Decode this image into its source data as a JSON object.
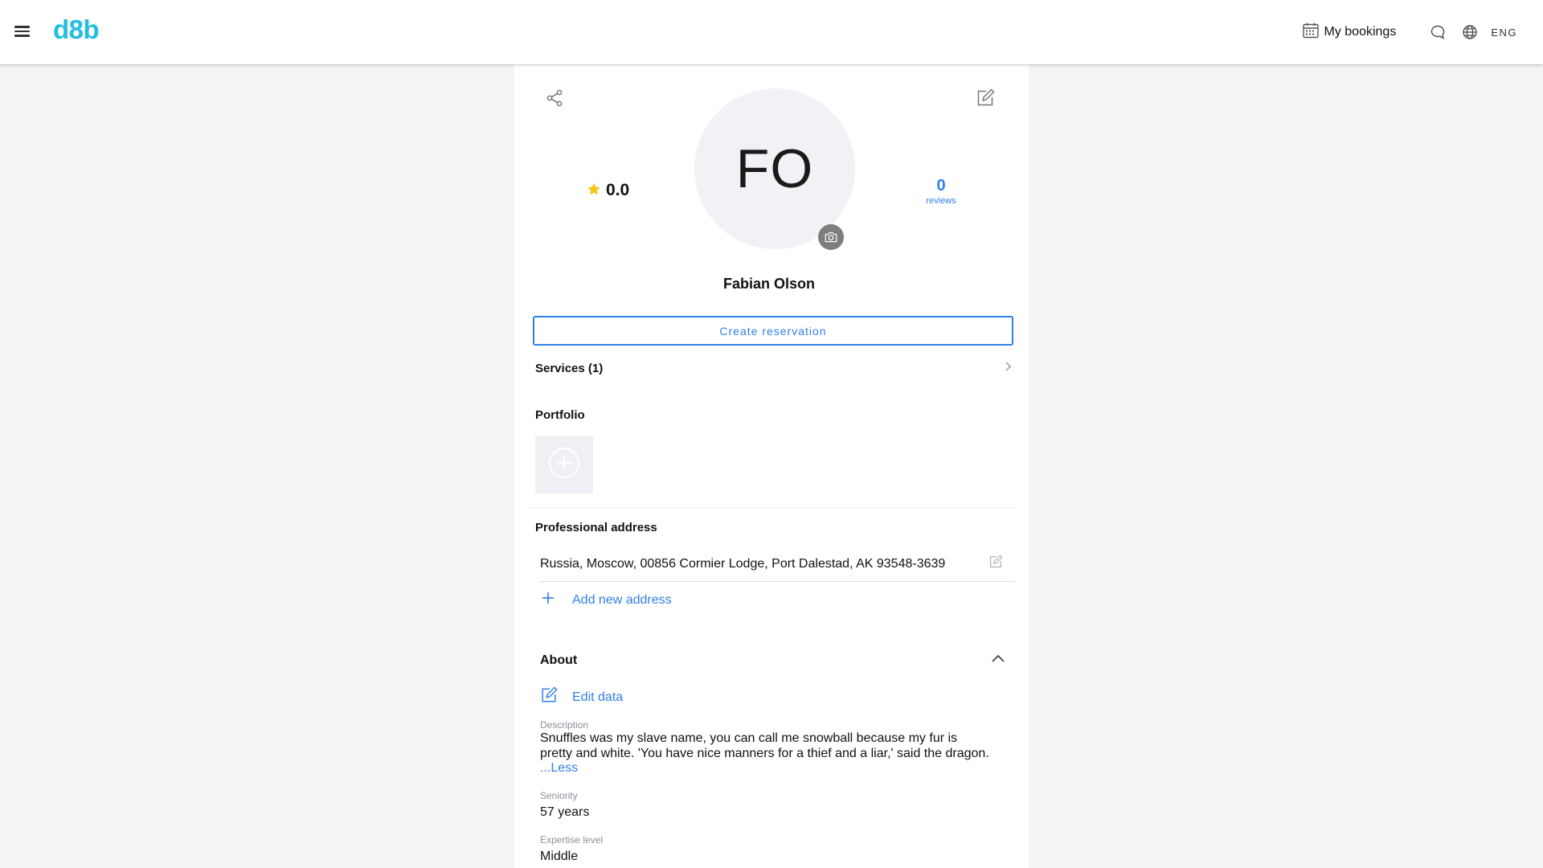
{
  "header": {
    "logo": "d8b",
    "bookings_label": "My bookings",
    "lang_label": "ENG"
  },
  "profile": {
    "initials": "FO",
    "rating": "0.0",
    "reviews_count": "0",
    "reviews_label": "reviews",
    "name": "Fabian Olson",
    "create_reservation_label": "Create reservation",
    "services_label": "Services (1)",
    "portfolio_title": "Portfolio",
    "address_title": "Professional address",
    "address": "Russia, Moscow, 00856 Cormier Lodge, Port Dalestad, AK 93548-3639",
    "add_address_label": "Add new address",
    "about_title": "About",
    "edit_data_label": "Edit data",
    "description_label": "Description",
    "description": "Snuffles was my slave name, you can call me snowball because my fur is pretty and white. 'You have nice manners for a thief and a liar,' said the dragon.",
    "less_label": "...Less",
    "seniority_label": "Seniority",
    "seniority": "57 years",
    "expertise_label": "Expertise level",
    "expertise": "Middle"
  },
  "colors": {
    "accent": "#2f7fe8",
    "logo": "#23bfe0",
    "star": "#f5c518"
  }
}
